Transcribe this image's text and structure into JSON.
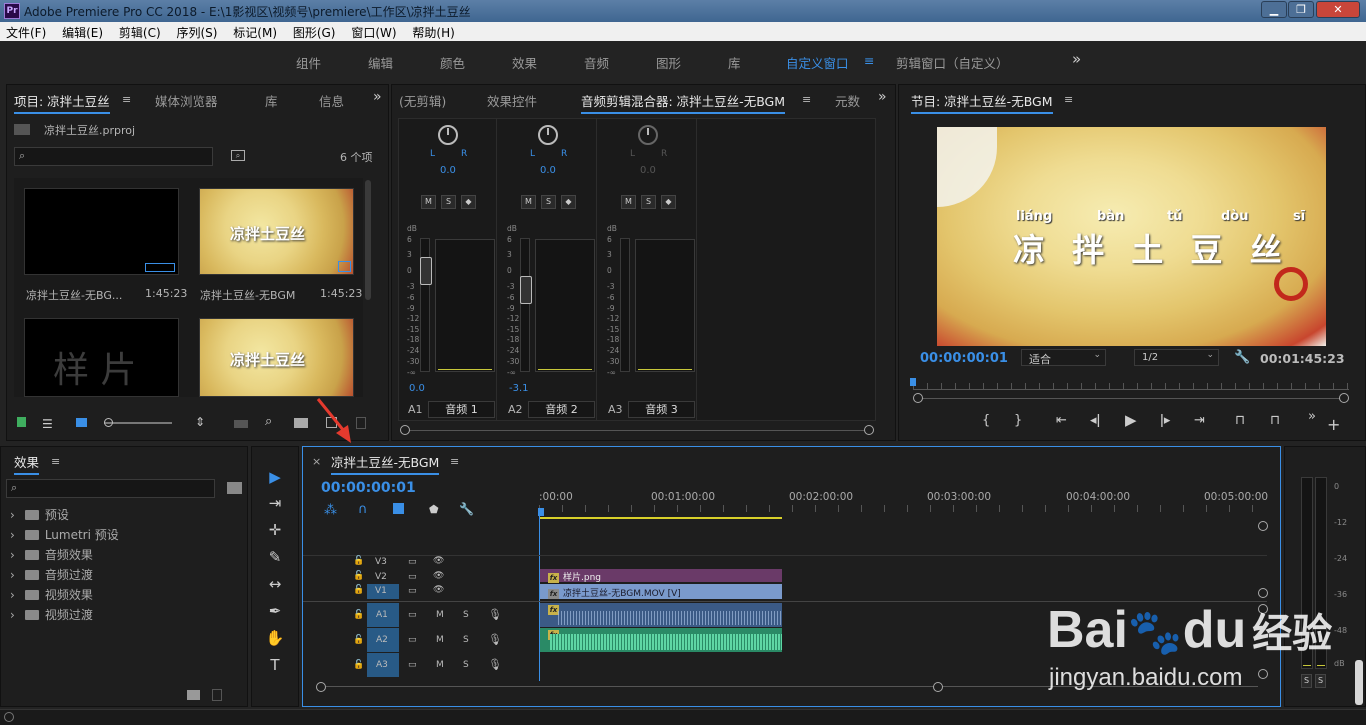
{
  "window": {
    "title": "Adobe Premiere Pro CC 2018 - E:\\1影视区\\视频号\\premiere\\工作区\\凉拌土豆丝",
    "logo": "Pr",
    "minimize": "▁",
    "maximize": "❐",
    "close": "✕"
  },
  "menu": [
    "文件(F)",
    "编辑(E)",
    "剪辑(C)",
    "序列(S)",
    "标记(M)",
    "图形(G)",
    "窗口(W)",
    "帮助(H)"
  ],
  "workspaces": {
    "items": [
      "组件",
      "编辑",
      "颜色",
      "效果",
      "音频",
      "图形",
      "库",
      "自定义窗口",
      "剪辑窗口（自定义）"
    ],
    "active": "自定义窗口",
    "more": "»",
    "menu_glyph": "≡"
  },
  "project_panel": {
    "tabs": [
      "项目: 凉拌土豆丝",
      "媒体浏览器",
      "库",
      "信息"
    ],
    "more": "»",
    "project_file": "凉拌土豆丝.prproj",
    "item_count": "6 个项",
    "items": [
      {
        "name": "凉拌土豆丝-无BG...",
        "duration": "1:45:23"
      },
      {
        "name": "凉拌土豆丝-无BGM",
        "duration": "1:45:23"
      },
      {
        "thumb_text": "样 片"
      },
      {
        "thumb_caption": "凉拌土豆丝"
      }
    ],
    "thumb_caption": "凉拌土豆丝"
  },
  "center_panel": {
    "tabs": [
      "(无剪辑)",
      "效果控件",
      "音频剪辑混合器: 凉拌土豆丝-无BGM",
      "元数"
    ],
    "more": "»",
    "lr_left": "L",
    "lr_right": "R",
    "m_label": "M",
    "s_label": "S",
    "db_label": "dB",
    "scale_marks": [
      "6",
      "3",
      "0",
      "-3",
      "-6",
      "-9",
      "-12",
      "-15",
      "-18",
      "-24",
      "-30",
      "-∞"
    ],
    "channels": [
      {
        "pan": "0.0",
        "value": "0.0",
        "id": "A1",
        "name": "音频 1"
      },
      {
        "pan": "0.0",
        "value": "-3.1",
        "id": "A2",
        "name": "音频 2"
      },
      {
        "pan": "0.0",
        "value": "",
        "id": "A3",
        "name": "音频 3"
      }
    ]
  },
  "program_monitor": {
    "title": "节目: 凉拌土豆丝-无BGM",
    "caption": "凉 拌 土 豆 丝",
    "pinyin": [
      "liáng",
      "bàn",
      "tǔ",
      "dòu",
      "sī"
    ],
    "timecode": "00:00:00:01",
    "fit": "适合",
    "resolution": "1/2",
    "duration": "00:01:45:23"
  },
  "effects_panel": {
    "title": "效果",
    "items": [
      "预设",
      "Lumetri 预设",
      "音频效果",
      "音频过渡",
      "视频效果",
      "视频过渡"
    ]
  },
  "tools": {
    "selection": "▶",
    "track_select": "⇥",
    "ripple": "✛",
    "razor": "✎",
    "slip": "↔",
    "pen": "✒",
    "hand": "✋",
    "type": "T"
  },
  "timeline": {
    "close": "×",
    "title": "凉拌土豆丝-无BGM",
    "timecode": "00:00:00:01",
    "ruler": [
      ":00:00",
      "00:01:00:00",
      "00:02:00:00",
      "00:03:00:00",
      "00:04:00:00",
      "00:05:00:00"
    ],
    "m_label": "M",
    "s_label": "S",
    "tracks": [
      "V3",
      "V2",
      "V1",
      "A1",
      "A2",
      "A3"
    ],
    "clips": {
      "v2": "样片.png",
      "v1": "凉拌土豆丝-无BGM.MOV [V]"
    },
    "fx_label": "fx"
  },
  "level_meter": {
    "marks": [
      "0",
      "-12",
      "-24",
      "-36",
      "-48",
      "dB"
    ],
    "solo": [
      "S",
      "S"
    ]
  },
  "watermark": {
    "brand": "Bai",
    "paw": "🐾",
    "du": "du",
    "cn": "经验",
    "url": "jingyan.baidu.com"
  },
  "colors": {
    "accent": "#3a8fe6",
    "v2_clip": "#6a3a68",
    "v1_clip": "#7a9acc",
    "audio_clip": "#3fae7f",
    "playhead": "#3a8fe6"
  }
}
